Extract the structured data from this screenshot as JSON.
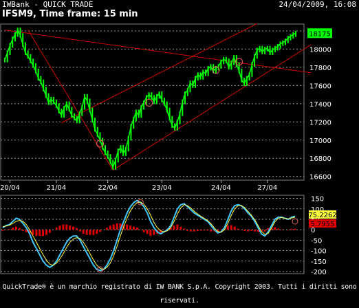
{
  "header": {
    "app_title": "IWBank - QUICK TRADE",
    "datetime": "24/04/2009, 16:08",
    "chart_title": "IFSM9, Time frame: 15 min"
  },
  "footer": {
    "text": "QuickTrade® è un marchio registrato di IW BANK S.p.A. Copyright 2003. Tutti i diritti sono riservati."
  },
  "colors": {
    "price": "#00ff00",
    "trendlines": "#d00000",
    "osc_cyan": "#40c8ff",
    "osc_yellow": "#ffff40",
    "histogram": "#e00000",
    "price_badge": "#00ff00",
    "osc_badge_1": "#ffff40",
    "osc_badge_2": "#e00000"
  },
  "chart_data": [
    {
      "type": "line",
      "title": "IFSM9, Time frame: 15 min",
      "x_tick_labels": [
        "20/04",
        "21/04",
        "22/04",
        "23/04",
        "24/04",
        "27/04"
      ],
      "y_ticks": [
        16600,
        16800,
        17000,
        17200,
        17400,
        17600,
        17800,
        18000,
        18200
      ],
      "ylim": [
        16560,
        18260
      ],
      "last_value_label": "18175",
      "series": [
        {
          "values": [
            17880,
            17960,
            18040,
            18110,
            18160,
            18210,
            18150,
            18050,
            17960,
            17920,
            17870,
            17820,
            17760,
            17680,
            17640,
            17560,
            17490,
            17410,
            17450,
            17420,
            17380,
            17320,
            17270,
            17350,
            17400,
            17340,
            17270,
            17240,
            17210,
            17290,
            17360,
            17480,
            17430,
            17330,
            17220,
            17120,
            17060,
            17000,
            16920,
            16860,
            16820,
            16760,
            16700,
            16780,
            16880,
            16920,
            16850,
            16900,
            17020,
            17150,
            17230,
            17310,
            17270,
            17360,
            17410,
            17470,
            17500,
            17470,
            17420,
            17480,
            17510,
            17440,
            17400,
            17330,
            17240,
            17160,
            17130,
            17200,
            17290,
            17420,
            17510,
            17550,
            17630,
            17600,
            17680,
            17720,
            17690,
            17750,
            17730,
            17790,
            17810,
            17760,
            17790,
            17810,
            17860,
            17890,
            17870,
            17800,
            17850,
            17910,
            17830,
            17760,
            17660,
            17620,
            17680,
            17720,
            17830,
            17920,
            17990,
            18010,
            17970,
            18000,
            18010,
            17960,
            17990,
            18010,
            18030,
            18060,
            18070,
            18090,
            18120,
            18140,
            18160,
            18175
          ]
        }
      ],
      "trendlines": [
        {
          "from": [
            0,
            18210
          ],
          "to": [
            119,
            17740
          ]
        },
        {
          "from": [
            22,
            17190
          ],
          "to": [
            98,
            18280
          ]
        },
        {
          "from": [
            42,
            16670
          ],
          "to": [
            119,
            18050
          ]
        },
        {
          "from": [
            9,
            18210
          ],
          "to": [
            42,
            16670
          ]
        }
      ],
      "circle_marks": [
        [
          37,
          16960
        ],
        [
          56,
          17410
        ],
        [
          82,
          17770
        ],
        [
          91,
          17860
        ]
      ],
      "circle_mark_color": "#e06060"
    },
    {
      "type": "line",
      "y_ticks": [
        150,
        100,
        50,
        0,
        -50,
        -100,
        -150,
        -200
      ],
      "ylim": [
        -210,
        165
      ],
      "badges": [
        "75.2262",
        "5.7955"
      ],
      "series": [
        {
          "color": "cyan",
          "values": [
            10,
            20,
            25,
            40,
            55,
            50,
            30,
            10,
            -20,
            -60,
            -90,
            -120,
            -150,
            -170,
            -180,
            -170,
            -150,
            -120,
            -90,
            -60,
            -40,
            -30,
            -30,
            -50,
            -80,
            -110,
            -140,
            -170,
            -190,
            -195,
            -190,
            -170,
            -140,
            -100,
            -50,
            0,
            40,
            80,
            110,
            130,
            140,
            130,
            110,
            80,
            40,
            10,
            -10,
            -20,
            -10,
            0,
            20,
            60,
            100,
            120,
            125,
            110,
            95,
            80,
            70,
            60,
            50,
            40,
            20,
            0,
            -15,
            -10,
            10,
            50,
            90,
            115,
            120,
            115,
            100,
            80,
            65,
            40,
            10,
            -20,
            -30,
            -10,
            20,
            50,
            60,
            60,
            55,
            50,
            60,
            65
          ]
        },
        {
          "color": "yellow",
          "values": [
            15,
            18,
            22,
            30,
            40,
            45,
            40,
            25,
            0,
            -30,
            -60,
            -90,
            -120,
            -145,
            -165,
            -170,
            -160,
            -140,
            -115,
            -85,
            -60,
            -45,
            -38,
            -42,
            -60,
            -85,
            -115,
            -145,
            -170,
            -185,
            -190,
            -180,
            -160,
            -125,
            -80,
            -30,
            15,
            55,
            90,
            115,
            130,
            132,
            122,
            100,
            70,
            35,
            10,
            -5,
            -10,
            -5,
            10,
            40,
            75,
            105,
            120,
            115,
            103,
            88,
            76,
            64,
            54,
            44,
            28,
            8,
            -8,
            -12,
            0,
            30,
            68,
            100,
            115,
            116,
            106,
            88,
            70,
            48,
            20,
            -8,
            -22,
            -18,
            8,
            38,
            55,
            58,
            55,
            52,
            56,
            60
          ]
        },
        {
          "color": "histogram",
          "values": [
            -5,
            -2,
            3,
            10,
            15,
            8,
            -5,
            -12,
            -18,
            -25,
            -30,
            -30,
            -30,
            -25,
            -15,
            0,
            10,
            20,
            25,
            25,
            20,
            15,
            8,
            -8,
            -20,
            -25,
            -25,
            -25,
            -20,
            -10,
            0,
            10,
            20,
            25,
            30,
            30,
            25,
            25,
            20,
            15,
            10,
            -2,
            -12,
            -20,
            -30,
            -25,
            -20,
            -15,
            0,
            5,
            10,
            20,
            25,
            15,
            5,
            -5,
            -8,
            -8,
            -6,
            -4,
            -4,
            -4,
            -8,
            -8,
            -7,
            2,
            10,
            20,
            22,
            15,
            5,
            -1,
            -6,
            -8,
            -5,
            -8,
            -10,
            -12,
            -8,
            8,
            12,
            12,
            5,
            2,
            0,
            -2,
            4,
            5
          ]
        }
      ]
    }
  ]
}
